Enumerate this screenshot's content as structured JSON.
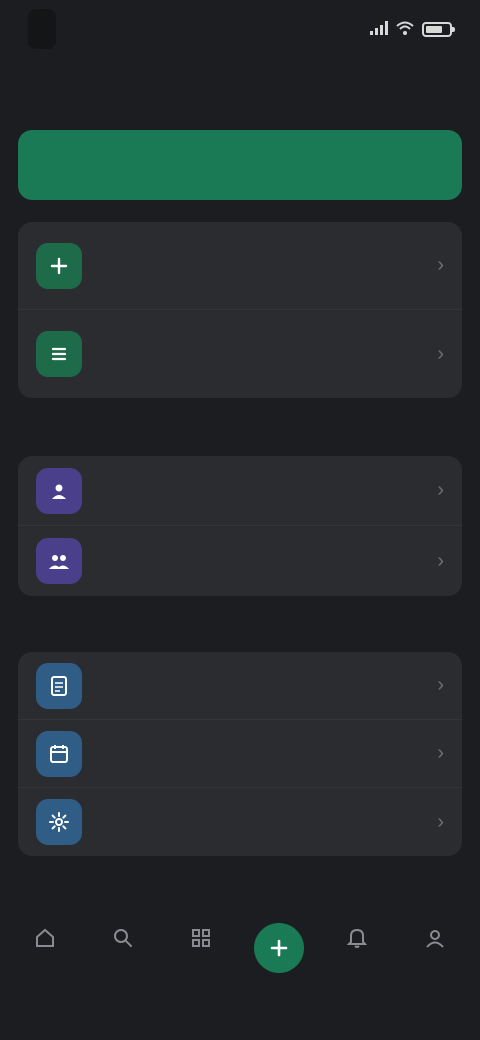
{
  "status_bar": {
    "time": "",
    "signal_icon": "signal-icon",
    "wifi_icon": "wifi-icon",
    "battery_icon": "battery-icon"
  },
  "page": {
    "title": ""
  },
  "primary_action": {
    "label": ""
  },
  "card_1": {
    "items": [
      {
        "label": "",
        "icon": "plus-icon",
        "color": "#1e6b4a"
      },
      {
        "label": "",
        "icon": "list-icon",
        "color": "#1e6b4a"
      }
    ]
  },
  "section_2": {
    "label": "",
    "items": [
      {
        "label": "",
        "icon": "person-icon",
        "color": "#4a3f8a"
      },
      {
        "label": "",
        "icon": "people-icon",
        "color": "#4a3f8a"
      }
    ]
  },
  "section_3": {
    "label": "",
    "items": [
      {
        "label": "",
        "icon": "document-icon",
        "color": "#2f5d86"
      },
      {
        "label": "",
        "icon": "calendar-icon",
        "color": "#2f5d86"
      },
      {
        "label": "",
        "icon": "gear-icon",
        "color": "#2f5d86"
      }
    ]
  },
  "section_4": {
    "label": ""
  },
  "tabs": [
    {
      "label": "",
      "icon": "home-icon",
      "active": false
    },
    {
      "label": "",
      "icon": "search-icon",
      "active": false
    },
    {
      "label": "",
      "icon": "grid-icon",
      "active": false
    },
    {
      "label": "",
      "icon": "plus-icon",
      "active": true
    },
    {
      "label": "",
      "icon": "bell-icon",
      "active": false
    },
    {
      "label": "",
      "icon": "profile-icon",
      "active": false
    }
  ],
  "colors": {
    "background": "#1c1d20",
    "card": "#2b2c30",
    "accent": "#1a7a55"
  }
}
